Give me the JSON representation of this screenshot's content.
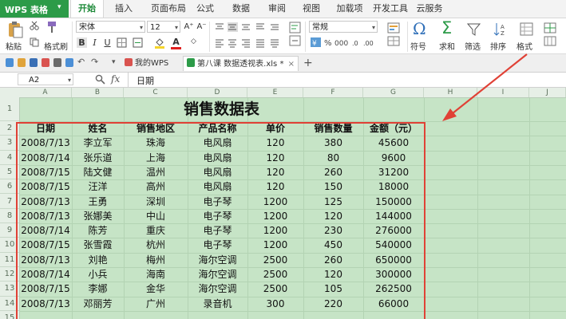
{
  "app": {
    "title": "WPS 表格"
  },
  "menu": [
    "开始",
    "插入",
    "页面布局",
    "公式",
    "数据",
    "审阅",
    "视图",
    "加载项",
    "开发工具",
    "云服务"
  ],
  "ribbon": {
    "paste": "粘贴",
    "format_painter": "格式刷",
    "font_name": "宋体",
    "font_size": "12",
    "number_format": "常规",
    "symbol": "符号",
    "sum": "求和",
    "filter": "筛选",
    "sort": "排序",
    "format": "格式"
  },
  "tabs": {
    "my_wps": "我的WPS",
    "document": "第八课 数据透视表.xls *"
  },
  "formula_bar": {
    "name_box": "A2",
    "fx": "fx",
    "content": "日期"
  },
  "columns": [
    "A",
    "B",
    "C",
    "D",
    "E",
    "F",
    "G",
    "H",
    "I",
    "J"
  ],
  "rows": [
    "1",
    "2",
    "3",
    "4",
    "5",
    "6",
    "7",
    "8",
    "9",
    "10",
    "11",
    "12",
    "13",
    "14",
    "15"
  ],
  "sheet": {
    "title": "销售数据表",
    "headers": [
      "日期",
      "姓名",
      "销售地区",
      "产品名称",
      "单价",
      "销售数量",
      "金额（元）"
    ],
    "rows": [
      [
        "2008/7/13",
        "李立军",
        "珠海",
        "电风扇",
        "120",
        "380",
        "45600"
      ],
      [
        "2008/7/14",
        "张乐道",
        "上海",
        "电风扇",
        "120",
        "80",
        "9600"
      ],
      [
        "2008/7/15",
        "陆文健",
        "温州",
        "电风扇",
        "120",
        "260",
        "31200"
      ],
      [
        "2008/7/15",
        "汪洋",
        "高州",
        "电风扇",
        "120",
        "150",
        "18000"
      ],
      [
        "2008/7/13",
        "王勇",
        "深圳",
        "电子琴",
        "1200",
        "125",
        "150000"
      ],
      [
        "2008/7/13",
        "张娜美",
        "中山",
        "电子琴",
        "1200",
        "120",
        "144000"
      ],
      [
        "2008/7/14",
        "陈芳",
        "重庆",
        "电子琴",
        "1200",
        "230",
        "276000"
      ],
      [
        "2008/7/15",
        "张雪霞",
        "杭州",
        "电子琴",
        "1200",
        "450",
        "540000"
      ],
      [
        "2008/7/13",
        "刘艳",
        "梅州",
        "海尔空调",
        "2500",
        "260",
        "650000"
      ],
      [
        "2008/7/14",
        "小兵",
        "海南",
        "海尔空调",
        "2500",
        "120",
        "300000"
      ],
      [
        "2008/7/15",
        "李娜",
        "金华",
        "海尔空调",
        "2500",
        "105",
        "262500"
      ],
      [
        "2008/7/13",
        "邓丽芳",
        "广州",
        "录音机",
        "300",
        "220",
        "66000"
      ]
    ]
  },
  "colors": {
    "accent": "#2c9b48",
    "sheet_bg": "#c6e4c6",
    "highlight": "#e04136"
  }
}
